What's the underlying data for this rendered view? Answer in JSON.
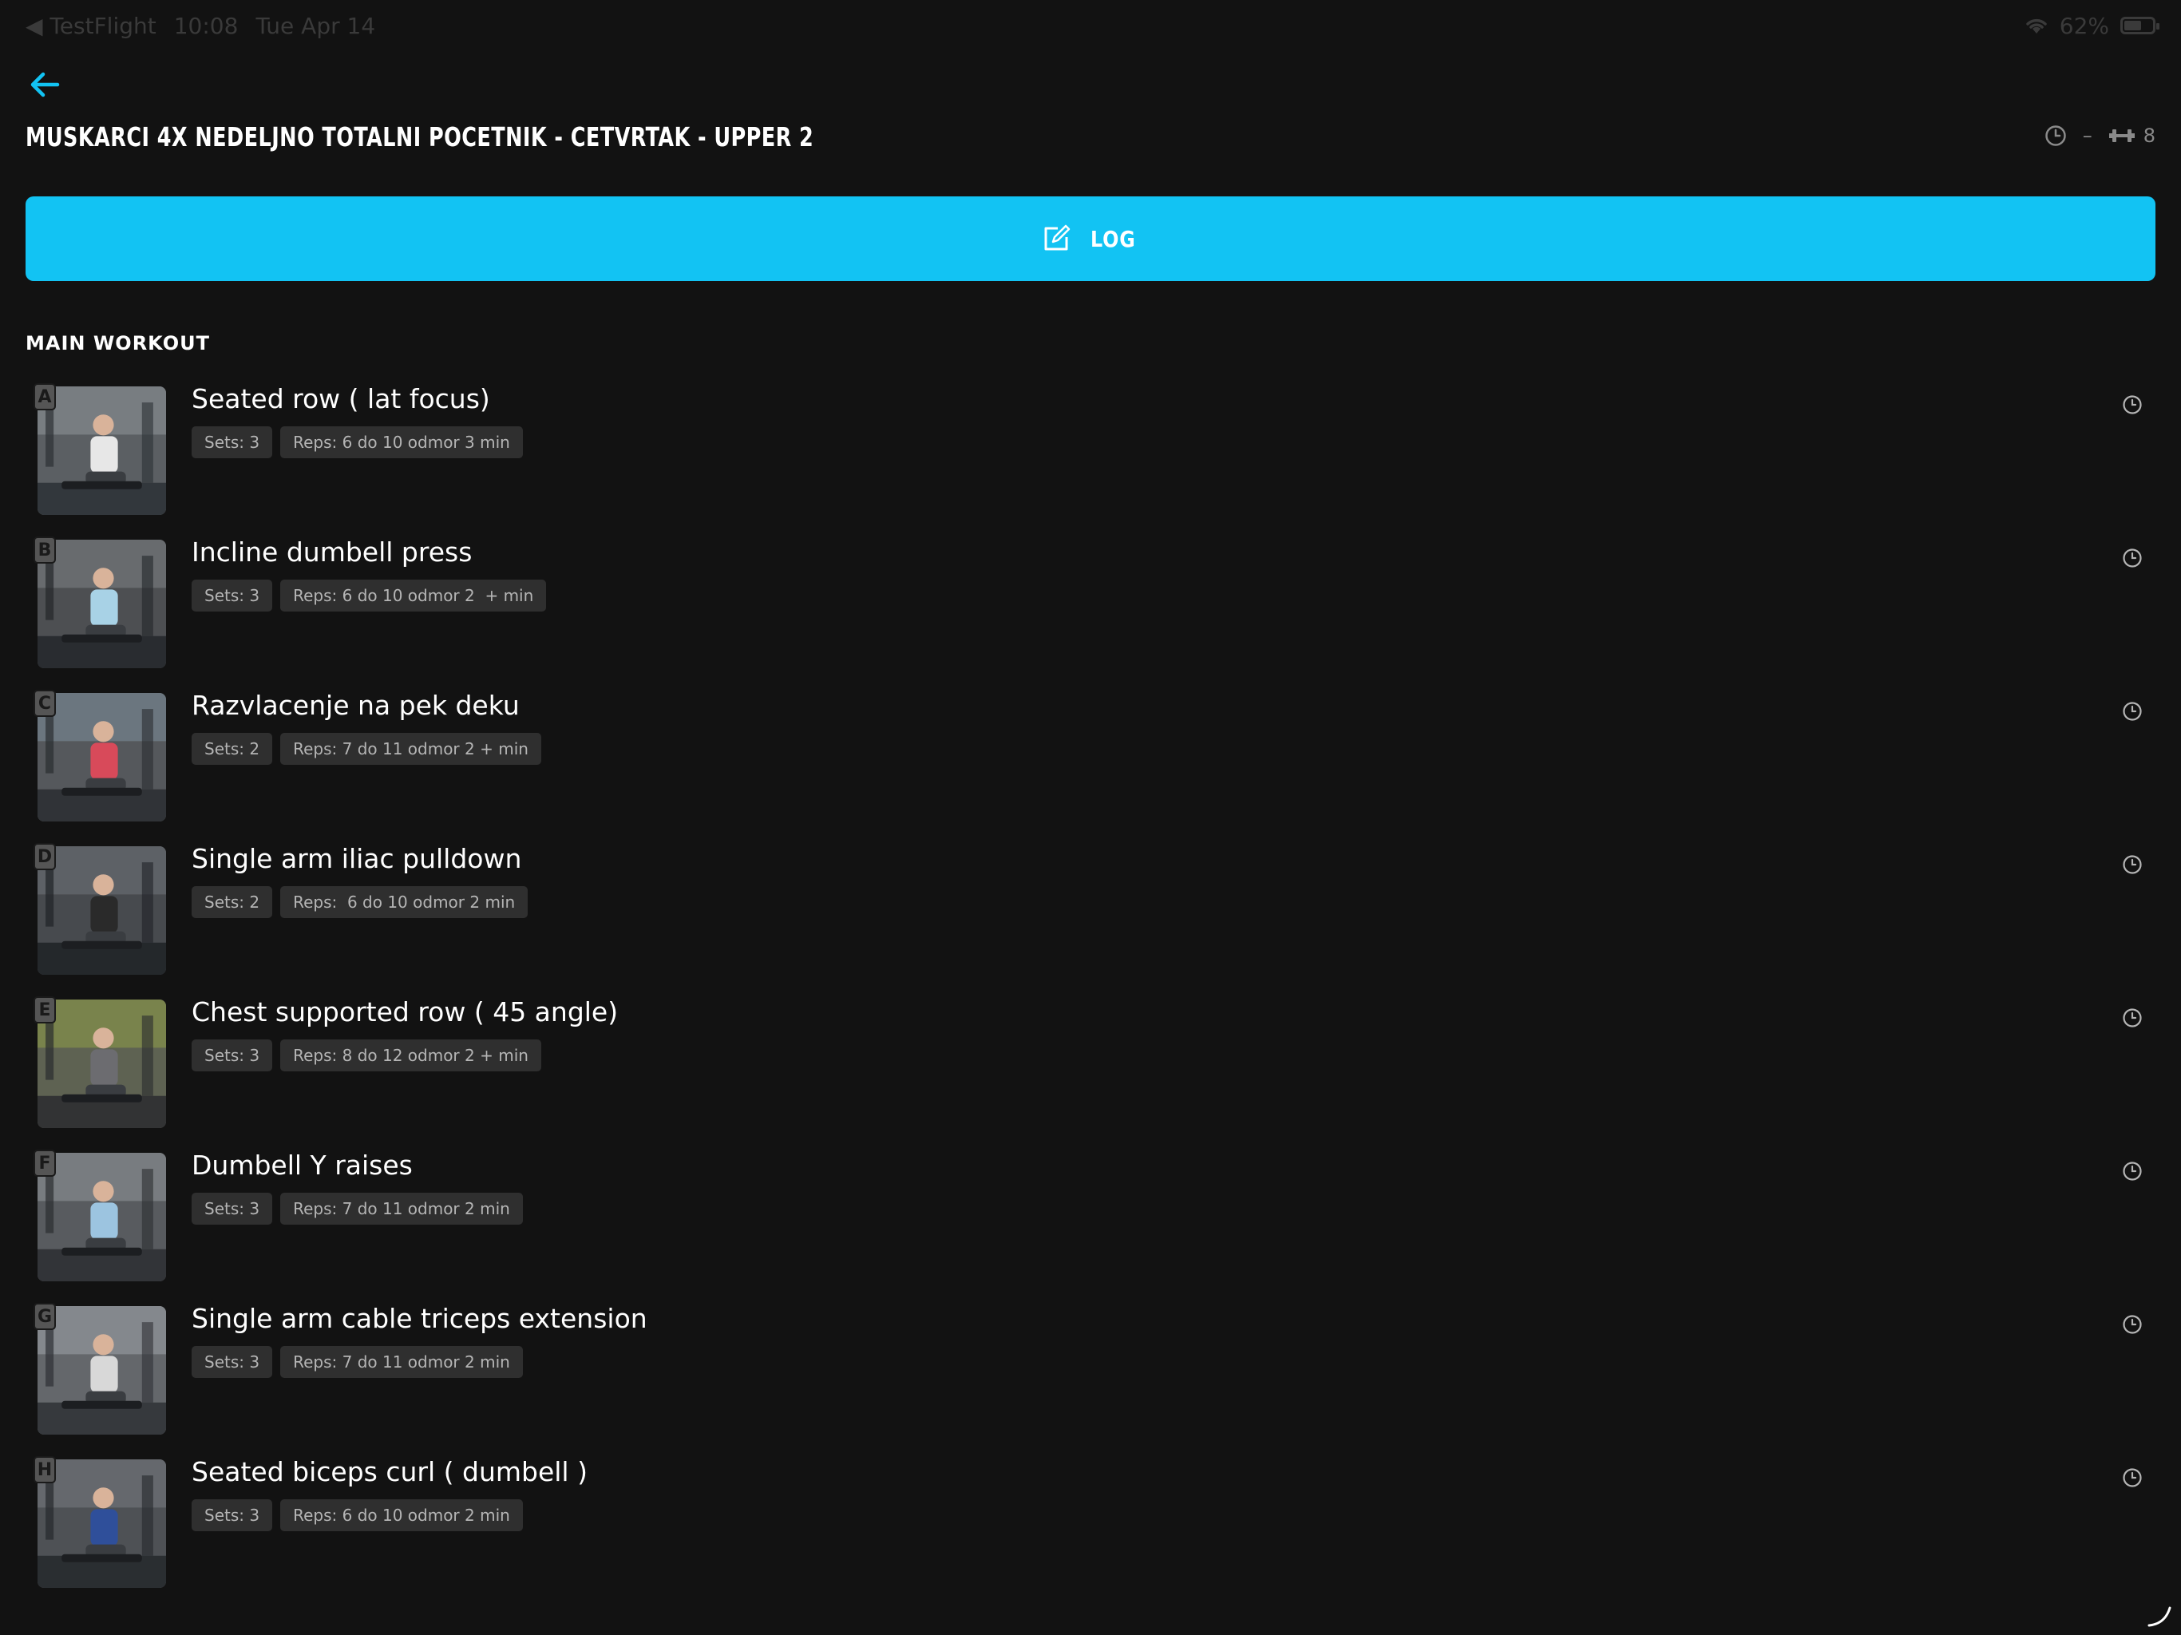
{
  "status_bar": {
    "back_app": "◀ TestFlight",
    "time": "10:08",
    "date": "Tue Apr 14",
    "battery": "62%",
    "battery_level": 0.62
  },
  "header": {
    "title": "MUSKARCI 4X NEDELJNO TOTALNI POCETNIK - CETVRTAK - UPPER 2",
    "duration": "–",
    "exercise_count": "8"
  },
  "log_button": {
    "label": "LOG"
  },
  "section": {
    "title": "MAIN WORKOUT"
  },
  "exercises": [
    {
      "letter": "A",
      "name": "Seated row ( lat focus)",
      "sets": "Sets: 3",
      "reps": "Reps: 6 do 10 odmor 3 min"
    },
    {
      "letter": "B",
      "name": "Incline dumbell press",
      "sets": "Sets: 3",
      "reps": "Reps: 6 do 10 odmor 2  + min"
    },
    {
      "letter": "C",
      "name": "Razvlacenje na pek deku",
      "sets": "Sets: 2",
      "reps": "Reps: 7 do 11 odmor 2 + min"
    },
    {
      "letter": "D",
      "name": "Single arm iliac pulldown",
      "sets": "Sets: 2",
      "reps": "Reps:  6 do 10 odmor 2 min"
    },
    {
      "letter": "E",
      "name": "Chest supported row ( 45 angle)",
      "sets": "Sets: 3",
      "reps": "Reps: 8 do 12 odmor 2 + min"
    },
    {
      "letter": "F",
      "name": "Dumbell Y raises",
      "sets": "Sets: 3",
      "reps": "Reps: 7 do 11 odmor 2 min"
    },
    {
      "letter": "G",
      "name": "Single arm cable triceps extension",
      "sets": "Sets: 3",
      "reps": "Reps: 7 do 11 odmor 2 min"
    },
    {
      "letter": "H",
      "name": "Seated biceps curl ( dumbell )",
      "sets": "Sets: 3",
      "reps": "Reps: 6 do 10 odmor 2 min"
    }
  ],
  "colors": {
    "background": "#121212",
    "accent": "#12c3f3",
    "tag_bg": "#2f2f2f",
    "tag_text": "#b5b5b5",
    "meta_text": "#8a8a8a"
  }
}
